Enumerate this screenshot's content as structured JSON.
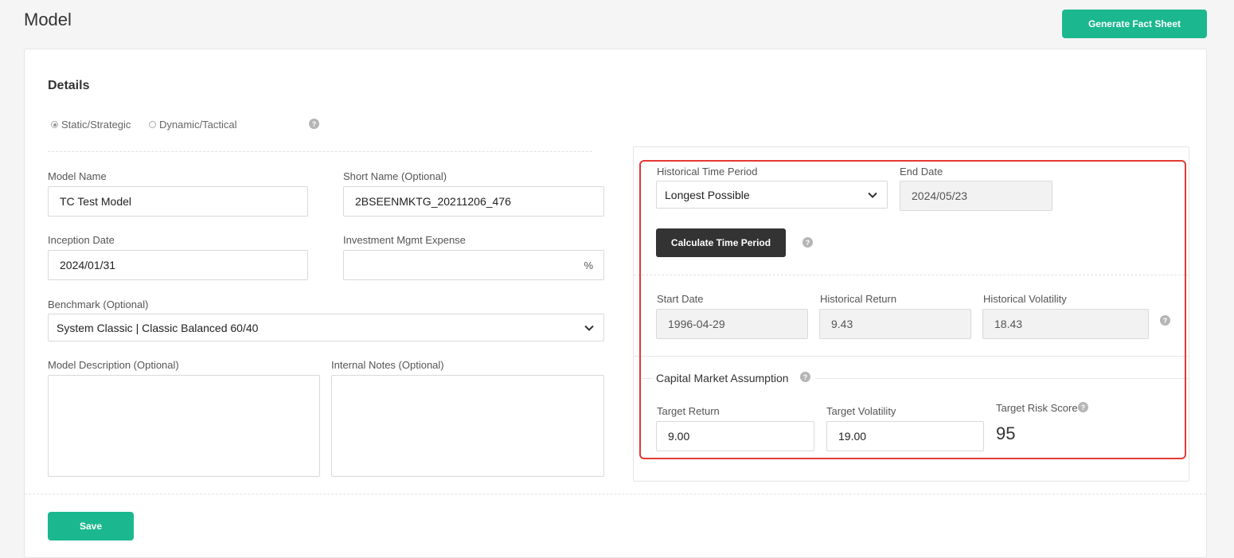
{
  "page": {
    "title": "Model"
  },
  "header": {
    "generate_label": "Generate Fact Sheet"
  },
  "details": {
    "title": "Details",
    "strategy_options": [
      "Static/Strategic",
      "Dynamic/Tactical"
    ],
    "strategy_selected": "Static/Strategic",
    "help_glyph": "?",
    "model_name": {
      "label": "Model Name",
      "value": "TC Test Model"
    },
    "short_name": {
      "label": "Short Name (Optional)",
      "value": "2BSEENMKTG_20211206_476"
    },
    "inception_date": {
      "label": "Inception Date",
      "value": "2024/01/31"
    },
    "mgmt_expense": {
      "label": "Investment Mgmt Expense",
      "value": "",
      "suffix": "%"
    },
    "benchmark": {
      "label": "Benchmark (Optional)",
      "value": "System Classic | Classic Balanced 60/40"
    },
    "description": {
      "label": "Model Description (Optional)",
      "value": ""
    },
    "internal_notes": {
      "label": "Internal Notes (Optional)",
      "value": ""
    }
  },
  "historical": {
    "time_period": {
      "label": "Historical Time Period",
      "value": "Longest Possible"
    },
    "end_date": {
      "label": "End Date",
      "value": "2024/05/23"
    },
    "calculate_label": "Calculate Time Period",
    "start_date": {
      "label": "Start Date",
      "value": "1996-04-29"
    },
    "return": {
      "label": "Historical Return",
      "value": "9.43"
    },
    "volatility": {
      "label": "Historical Volatility",
      "value": "18.43"
    }
  },
  "cma": {
    "title": "Capital Market Assumption",
    "target_return": {
      "label": "Target Return",
      "value": "9.00"
    },
    "target_volatility": {
      "label": "Target Volatility",
      "value": "19.00"
    },
    "risk_score": {
      "label": "Target Risk Score",
      "value": "95"
    }
  },
  "footer": {
    "save_label": "Save"
  },
  "colors": {
    "accent": "#1bb88f",
    "dark_button": "#333333",
    "highlight": "#e53935"
  },
  "icons": {
    "help": "question-circle-icon",
    "dropdown": "chevron-down-icon",
    "radio": "radio-icon"
  }
}
